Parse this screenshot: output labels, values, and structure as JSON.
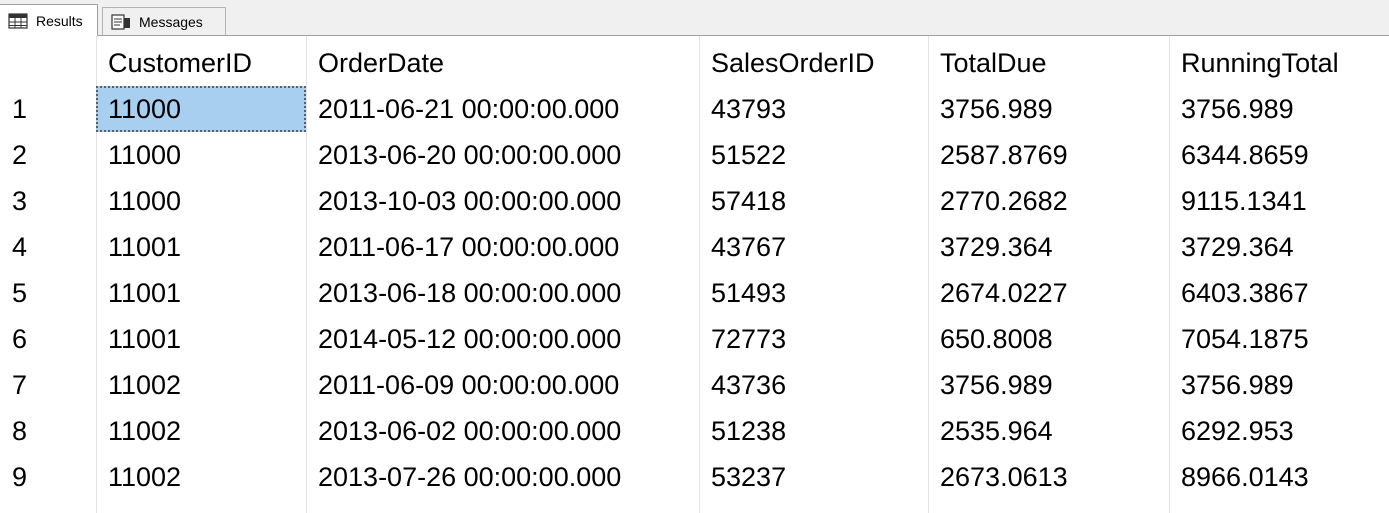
{
  "tabs": [
    {
      "label": "Results",
      "icon": "grid-icon",
      "active": true
    },
    {
      "label": "Messages",
      "icon": "messages-icon",
      "active": false
    }
  ],
  "grid": {
    "columns": [
      "CustomerID",
      "OrderDate",
      "SalesOrderID",
      "TotalDue",
      "RunningTotal"
    ],
    "rows": [
      {
        "num": "1",
        "cells": [
          "11000",
          "2011-06-21 00:00:00.000",
          "43793",
          "3756.989",
          "3756.989"
        ]
      },
      {
        "num": "2",
        "cells": [
          "11000",
          "2013-06-20 00:00:00.000",
          "51522",
          "2587.8769",
          "6344.8659"
        ]
      },
      {
        "num": "3",
        "cells": [
          "11000",
          "2013-10-03 00:00:00.000",
          "57418",
          "2770.2682",
          "9115.1341"
        ]
      },
      {
        "num": "4",
        "cells": [
          "11001",
          "2011-06-17 00:00:00.000",
          "43767",
          "3729.364",
          "3729.364"
        ]
      },
      {
        "num": "5",
        "cells": [
          "11001",
          "2013-06-18 00:00:00.000",
          "51493",
          "2674.0227",
          "6403.3867"
        ]
      },
      {
        "num": "6",
        "cells": [
          "11001",
          "2014-05-12 00:00:00.000",
          "72773",
          "650.8008",
          "7054.1875"
        ]
      },
      {
        "num": "7",
        "cells": [
          "11002",
          "2011-06-09 00:00:00.000",
          "43736",
          "3756.989",
          "3756.989"
        ]
      },
      {
        "num": "8",
        "cells": [
          "11002",
          "2013-06-02 00:00:00.000",
          "51238",
          "2535.964",
          "6292.953"
        ]
      },
      {
        "num": "9",
        "cells": [
          "11002",
          "2013-07-26 00:00:00.000",
          "53237",
          "2673.0613",
          "8966.0143"
        ]
      }
    ],
    "selection_color": "#a8cff0"
  }
}
